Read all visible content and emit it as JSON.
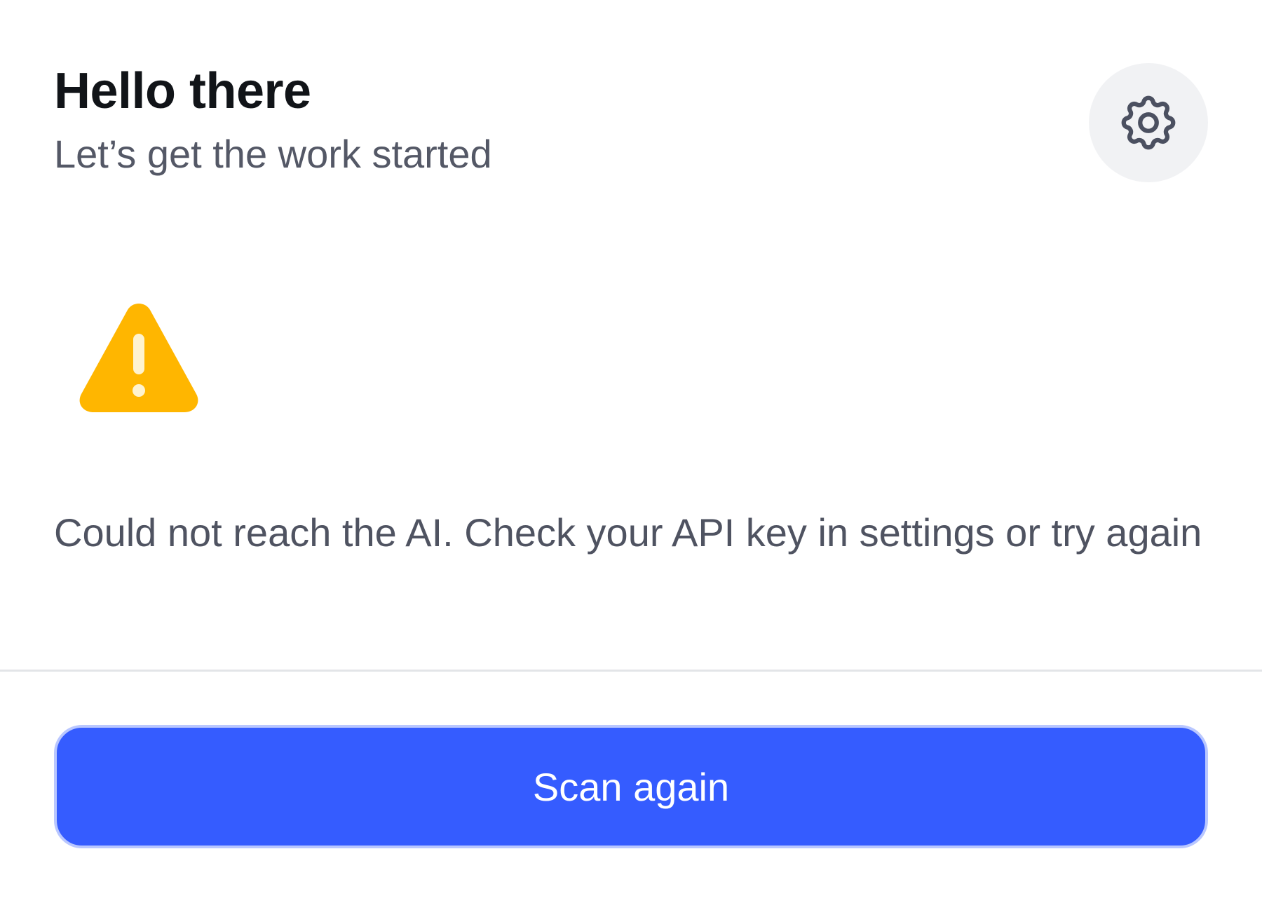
{
  "header": {
    "title": "Hello there",
    "subtitle": "Let’s get the work started"
  },
  "settings_button": {
    "icon": "gear-icon"
  },
  "status": {
    "icon": "warning-icon",
    "message": "Could not reach the AI. Check your API key in settings or try again"
  },
  "actions": {
    "scan_again_label": "Scan again"
  },
  "colors": {
    "accent": "#355cff",
    "warning": "#ffb600",
    "title_text": "#111418",
    "secondary_text": "#545866",
    "settings_bg": "#f1f2f4"
  }
}
